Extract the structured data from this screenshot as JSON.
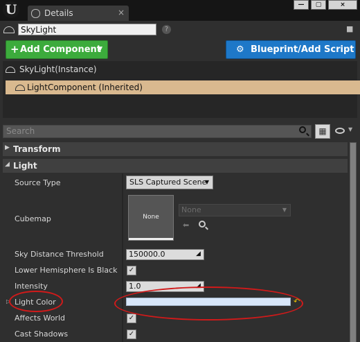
{
  "window": {
    "logo": "U",
    "tab_label": "Details",
    "tab_close": "×",
    "win_minimize": "—",
    "win_maximize": "▢",
    "win_close": "×"
  },
  "actor": {
    "name": "SkyLight",
    "help": "?",
    "lock": "🔒"
  },
  "toolbar": {
    "add_component_plus": "+",
    "add_component_label": "Add Component",
    "add_component_caret": "▼",
    "blueprint_icon": "⚙",
    "blueprint_label": "Blueprint/Add Script"
  },
  "components": {
    "instance": "SkyLight(Instance)",
    "selected": "LightComponent (Inherited)"
  },
  "search": {
    "placeholder": "Search"
  },
  "view_options": {
    "grid": "▦",
    "caret": "▼"
  },
  "categories": {
    "transform": "Transform",
    "transform_arrow": "▶",
    "light": "Light",
    "light_arrow": "◢"
  },
  "properties": {
    "source_type": {
      "label": "Source Type",
      "value": "SLS Captured Scene",
      "caret": "▼"
    },
    "cubemap": {
      "label": "Cubemap",
      "thumb": "None",
      "asset": "None",
      "caret": "▼",
      "use": "⬅"
    },
    "sky_distance": {
      "label": "Sky Distance Threshold",
      "value": "150000.0"
    },
    "lower_hemisphere": {
      "label": "Lower Hemisphere Is Black",
      "checked": "✓"
    },
    "intensity": {
      "label": "Intensity",
      "value": "1.0"
    },
    "light_color": {
      "label": "Light Color",
      "color": "#d8e7fa",
      "reset": "↶",
      "expand": "▷"
    },
    "affects_world": {
      "label": "Affects World",
      "checked": "✓"
    },
    "cast_shadows": {
      "label": "Cast Shadows",
      "checked": "✓"
    }
  },
  "annotation_color": "#d11a1a"
}
